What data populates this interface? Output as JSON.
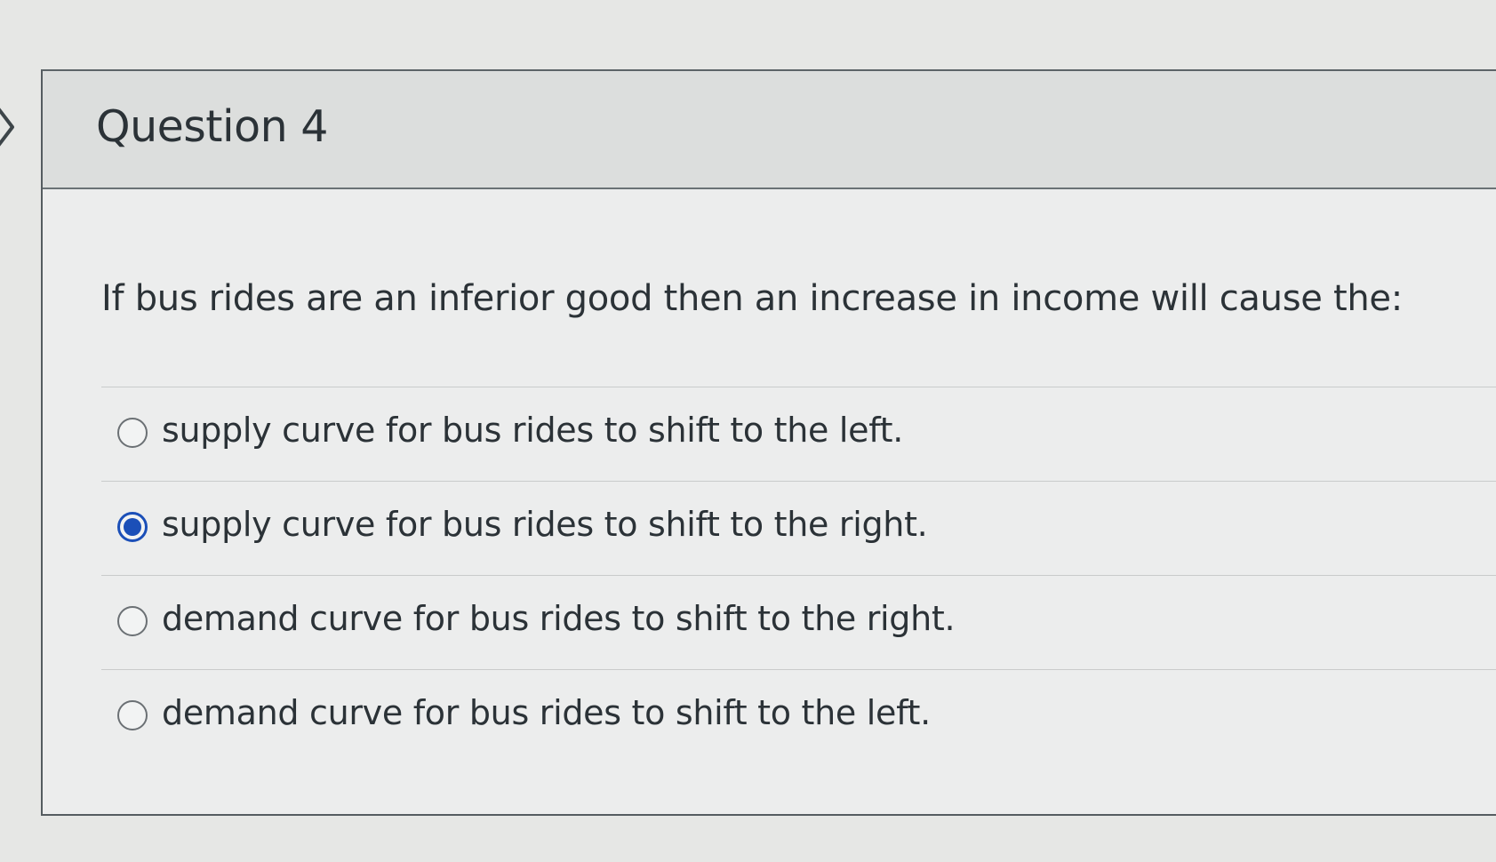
{
  "question": {
    "title": "Question 4",
    "text": "If bus rides are an inferior good then an increase in income will cause the:",
    "answers": [
      {
        "label": "supply curve for bus rides to shift to the left.",
        "selected": false
      },
      {
        "label": "supply curve for bus rides to shift to the right.",
        "selected": true
      },
      {
        "label": "demand curve for bus rides to shift to the right.",
        "selected": false
      },
      {
        "label": "demand curve for bus rides to shift to the left.",
        "selected": false
      }
    ]
  },
  "icons": {
    "collapse": "chevron-right-icon"
  },
  "colors": {
    "selected_radio": "#1b4fb8",
    "text": "#2b3237",
    "header_bg": "#dcdedd"
  }
}
